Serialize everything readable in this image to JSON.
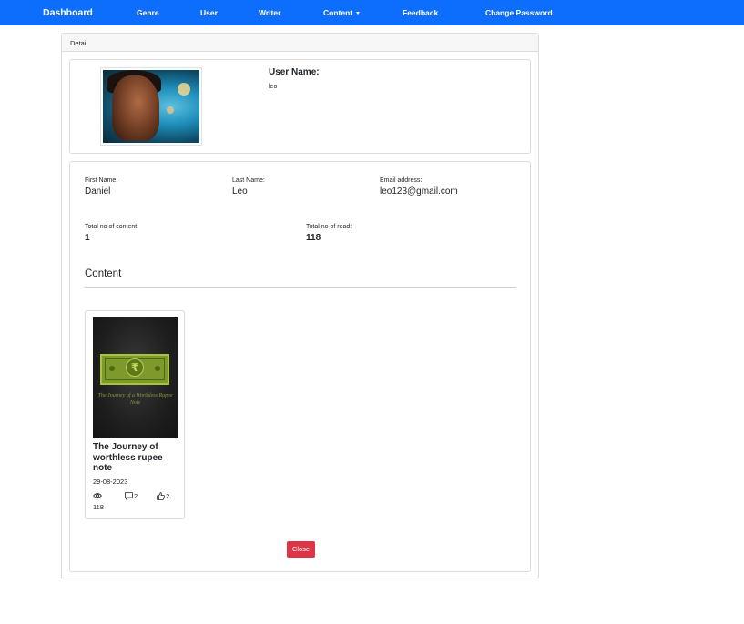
{
  "navbar": {
    "brand": "Dashboard",
    "links": [
      "Genre",
      "User",
      "Writer",
      "Content",
      "Feedback",
      "Change Password"
    ]
  },
  "detail": {
    "header": "Detail",
    "profile": {
      "username_label": "User Name:",
      "username_value": "leo"
    },
    "info": {
      "first_name_label": "First Name:",
      "first_name_value": "Daniel",
      "last_name_label": "Last Name:",
      "last_name_value": "Leo",
      "email_label": "Email address:",
      "email_value": "leo123@gmail.com",
      "total_content_label": "Total no of content:",
      "total_content_value": "1",
      "total_read_label": "Total no of read:",
      "total_read_value": "118"
    },
    "content_section": {
      "title": "Content",
      "items": [
        {
          "cover_text": "The Journey of a Worthless Rupee Note",
          "title": "The Journey of worthless rupee note",
          "date": "29-08-2023",
          "views": "118",
          "comments": "2",
          "likes": "2"
        }
      ]
    },
    "close_label": "Close"
  },
  "colors": {
    "navbar": "#0d6efd",
    "danger": "#dc3545"
  }
}
